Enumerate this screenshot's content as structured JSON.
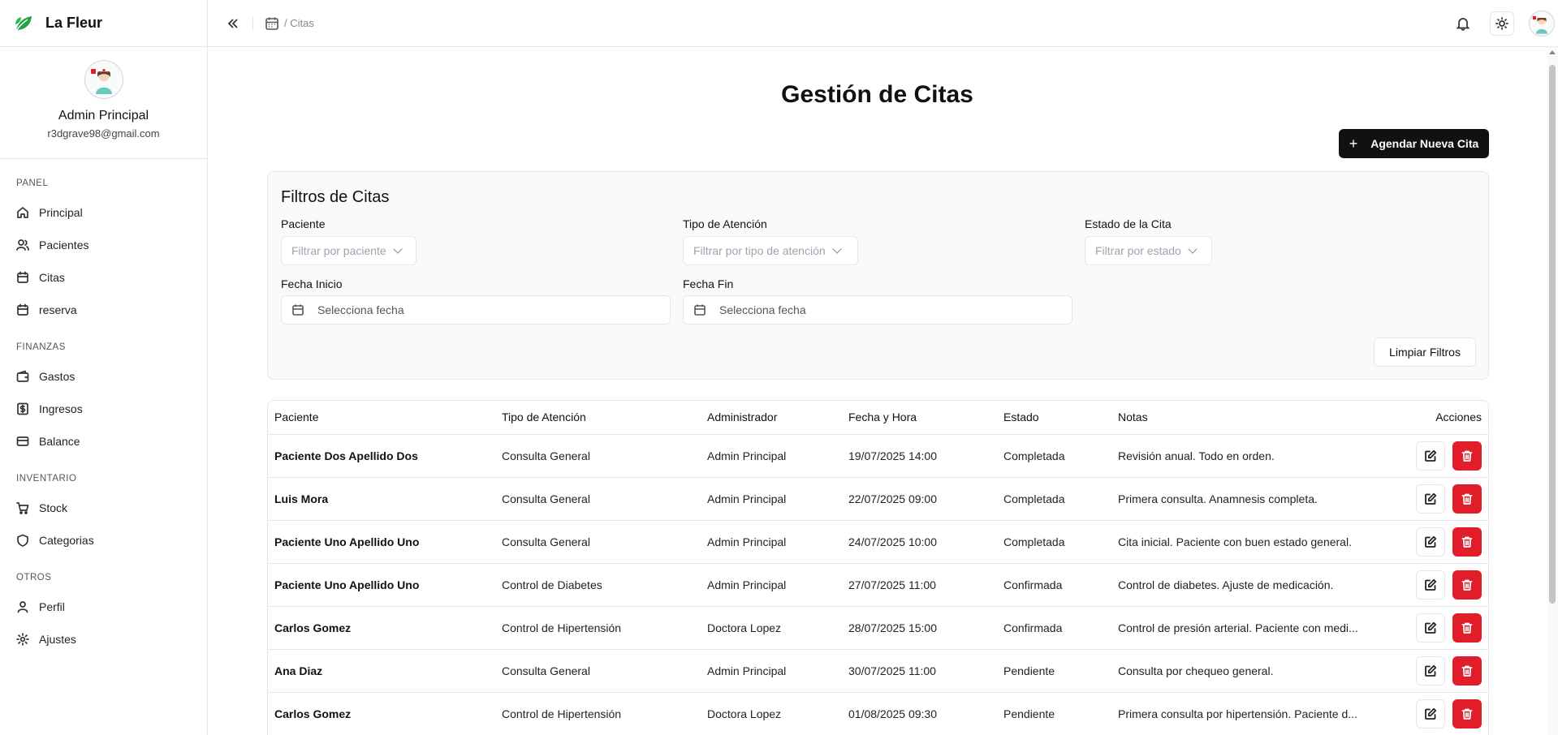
{
  "brand": {
    "name": "La Fleur",
    "accent": "#22a04b"
  },
  "user": {
    "name": "Admin Principal",
    "email": "r3dgrave98@gmail.com"
  },
  "nav": {
    "sections": [
      {
        "title": "PANEL",
        "items": [
          {
            "label": "Principal",
            "icon": "home-icon"
          },
          {
            "label": "Pacientes",
            "icon": "users-icon"
          },
          {
            "label": "Citas",
            "icon": "calendar-icon"
          },
          {
            "label": "reserva",
            "icon": "calendar-icon"
          }
        ]
      },
      {
        "title": "FINANZAS",
        "items": [
          {
            "label": "Gastos",
            "icon": "wallet-icon"
          },
          {
            "label": "Ingresos",
            "icon": "dollar-icon"
          },
          {
            "label": "Balance",
            "icon": "card-icon"
          }
        ]
      },
      {
        "title": "INVENTARIO",
        "items": [
          {
            "label": "Stock",
            "icon": "cart-icon"
          },
          {
            "label": "Categorias",
            "icon": "shield-icon"
          }
        ]
      },
      {
        "title": "OTROS",
        "items": [
          {
            "label": "Perfil",
            "icon": "user-icon"
          },
          {
            "label": "Ajustes",
            "icon": "gear-icon"
          }
        ]
      }
    ]
  },
  "header": {
    "breadcrumb": "/ Citas"
  },
  "page": {
    "title": "Gestión de Citas",
    "new_button": "Agendar Nueva Cita"
  },
  "filters": {
    "title": "Filtros de Citas",
    "paciente_label": "Paciente",
    "paciente_placeholder": "Filtrar por paciente",
    "tipo_label": "Tipo de Atención",
    "tipo_placeholder": "Filtrar por tipo de atención",
    "estado_label": "Estado de la Cita",
    "estado_placeholder": "Filtrar por estado",
    "inicio_label": "Fecha Inicio",
    "inicio_placeholder": "Selecciona fecha",
    "fin_label": "Fecha Fin",
    "fin_placeholder": "Selecciona fecha",
    "clear_button": "Limpiar Filtros"
  },
  "table": {
    "columns": [
      "Paciente",
      "Tipo de Atención",
      "Administrador",
      "Fecha y Hora",
      "Estado",
      "Notas",
      "Acciones"
    ],
    "rows": [
      [
        "Paciente Dos Apellido Dos",
        "Consulta General",
        "Admin Principal",
        "19/07/2025 14:00",
        "Completada",
        "Revisión anual. Todo en orden."
      ],
      [
        "Luis Mora",
        "Consulta General",
        "Admin Principal",
        "22/07/2025 09:00",
        "Completada",
        "Primera consulta. Anamnesis completa."
      ],
      [
        "Paciente Uno Apellido Uno",
        "Consulta General",
        "Admin Principal",
        "24/07/2025 10:00",
        "Completada",
        "Cita inicial. Paciente con buen estado general."
      ],
      [
        "Paciente Uno Apellido Uno",
        "Control de Diabetes",
        "Admin Principal",
        "27/07/2025 11:00",
        "Confirmada",
        "Control de diabetes. Ajuste de medicación."
      ],
      [
        "Carlos Gomez",
        "Control de Hipertensión",
        "Doctora Lopez",
        "28/07/2025 15:00",
        "Confirmada",
        "Control de presión arterial. Paciente con medi..."
      ],
      [
        "Ana Diaz",
        "Consulta General",
        "Admin Principal",
        "30/07/2025 11:00",
        "Pendiente",
        "Consulta por chequeo general."
      ],
      [
        "Carlos Gomez",
        "Control de Hipertensión",
        "Doctora Lopez",
        "01/08/2025 09:30",
        "Pendiente",
        "Primera consulta por hipertensión. Paciente d..."
      ]
    ]
  },
  "colors": {
    "primary": "#111111",
    "danger": "#e11d2a",
    "border": "#e5e7eb"
  }
}
